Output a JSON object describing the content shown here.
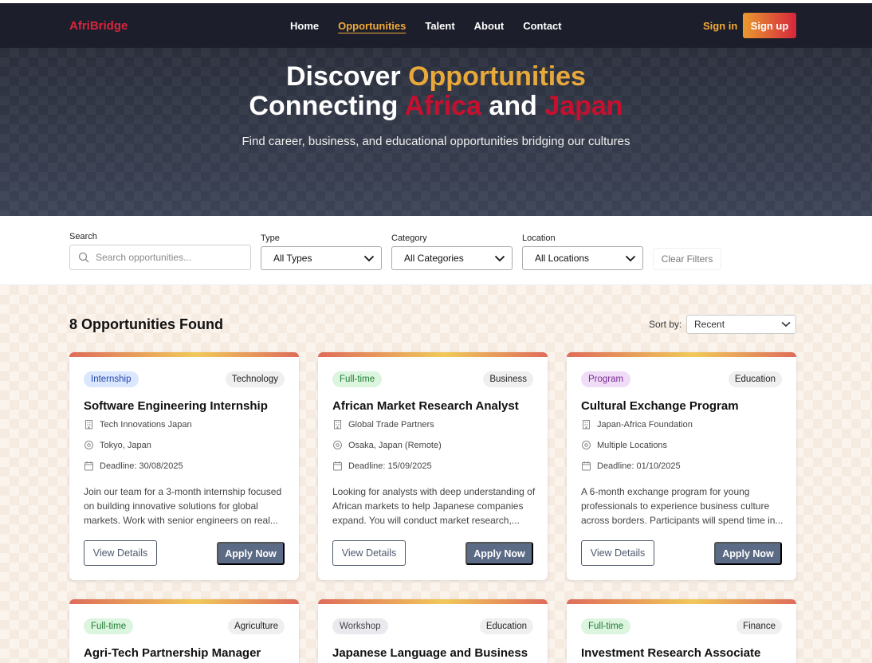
{
  "nav": {
    "logo": "AfriBridge",
    "links": [
      "Home",
      "Opportunities",
      "Talent",
      "About",
      "Contact"
    ],
    "signin": "Sign in",
    "signup": "Sign up"
  },
  "hero": {
    "line1_a": "Discover ",
    "line1_b": "Opportunities",
    "line2_a": "Connecting ",
    "line2_b": "Africa",
    "line2_c": " and ",
    "line2_d": "Japan",
    "subtitle": "Find career, business, and educational opportunities bridging our cultures"
  },
  "filters": {
    "search_label": "Search",
    "search_placeholder": "Search opportunities...",
    "type_label": "Type",
    "type_value": "All Types",
    "category_label": "Category",
    "category_value": "All Categories",
    "location_label": "Location",
    "location_value": "All Locations",
    "clear_label": "Clear Filters"
  },
  "results": {
    "count_text": "8 Opportunities Found",
    "sort_label": "Sort by:",
    "sort_value": "Recent"
  },
  "cards": [
    {
      "type": "Internship",
      "type_color": "blue",
      "category": "Technology",
      "title": "Software Engineering Internship",
      "company": "Tech Innovations Japan",
      "location": "Tokyo, Japan",
      "deadline": "Deadline: 30/08/2025",
      "description": "Join our team for a 3-month internship focused on building innovative solutions for global markets. Work with senior engineers on real...",
      "view_label": "View Details",
      "apply_label": "Apply Now"
    },
    {
      "type": "Full-time",
      "type_color": "green",
      "category": "Business",
      "title": "African Market Research Analyst",
      "company": "Global Trade Partners",
      "location": "Osaka, Japan (Remote)",
      "deadline": "Deadline: 15/09/2025",
      "description": "Looking for analysts with deep understanding of African markets to help Japanese companies expand. You will conduct market research,...",
      "view_label": "View Details",
      "apply_label": "Apply Now"
    },
    {
      "type": "Program",
      "type_color": "purple",
      "category": "Education",
      "title": "Cultural Exchange Program",
      "company": "Japan-Africa Foundation",
      "location": "Multiple Locations",
      "deadline": "Deadline: 01/10/2025",
      "description": "A 6-month exchange program for young professionals to experience business culture across borders. Participants will spend time in...",
      "view_label": "View Details",
      "apply_label": "Apply Now"
    },
    {
      "type": "Full-time",
      "type_color": "green",
      "category": "Agriculture",
      "title": "Agri-Tech Partnership Manager"
    },
    {
      "type": "Workshop",
      "type_color": "gray",
      "category": "Education",
      "title": "Japanese Language and Business"
    },
    {
      "type": "Full-time",
      "type_color": "green",
      "category": "Finance",
      "title": "Investment Research Associate"
    }
  ],
  "colors": {
    "navbar": "#1c1f2b",
    "accent_gold": "#e8a93a",
    "accent_red": "#c8102e",
    "button_primary": "#5c6b85"
  }
}
